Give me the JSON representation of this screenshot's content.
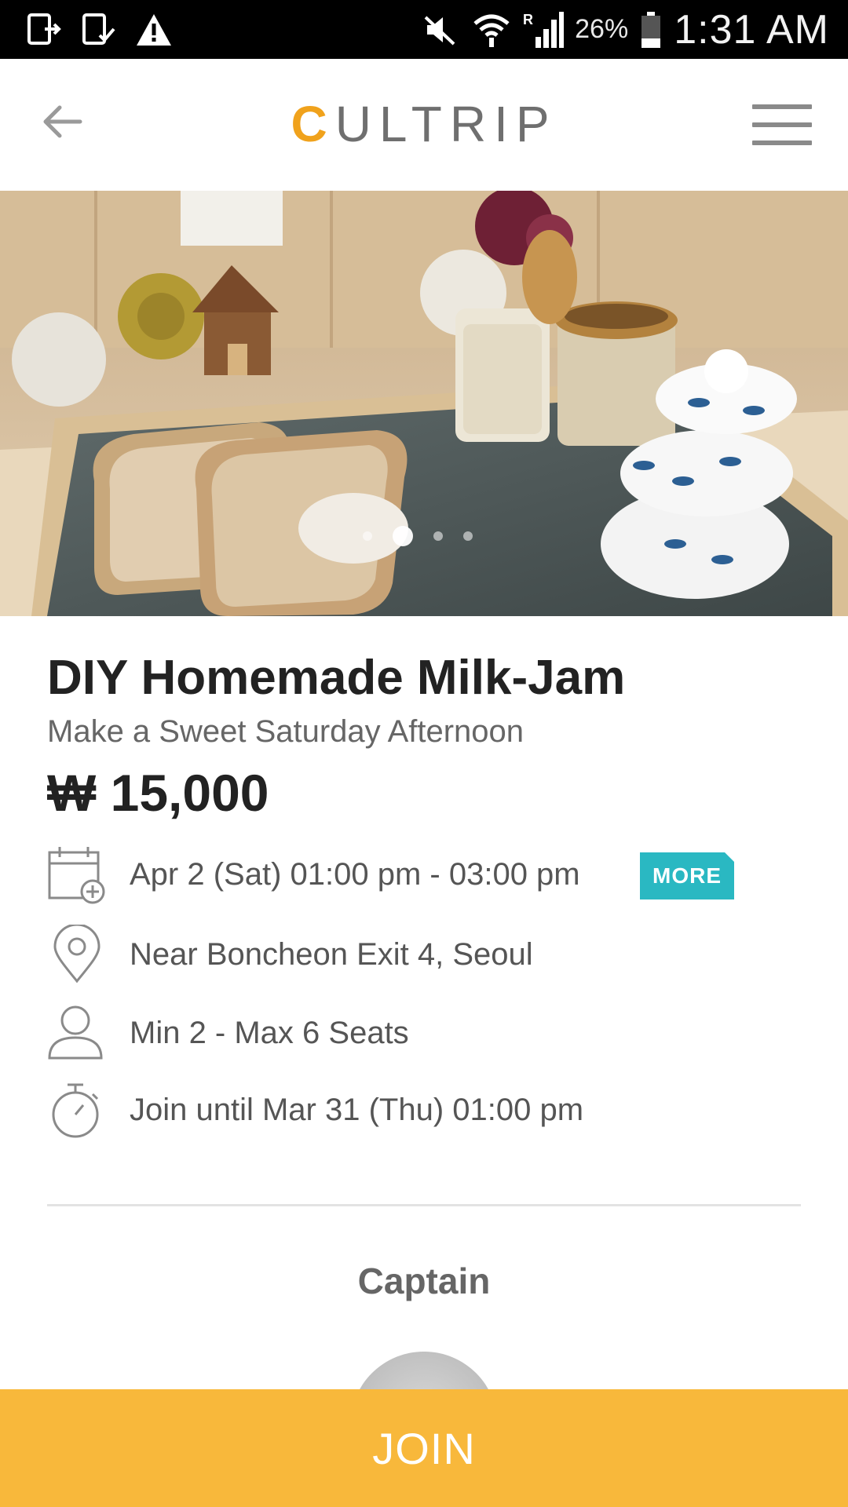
{
  "status_bar": {
    "battery_percent": "26%",
    "time": "1:31 AM",
    "icons": [
      "download-icon",
      "download-done-icon",
      "warning-icon",
      "mute-icon",
      "wifi-icon",
      "signal-icon",
      "battery-icon"
    ]
  },
  "header": {
    "logo": {
      "first_letter": "C",
      "rest": "ULTRIP"
    },
    "back_icon": "back-arrow-icon",
    "menu_icon": "hamburger-menu-icon",
    "accent_color": "#f0a21c"
  },
  "carousel": {
    "total_slides": 4,
    "active_slide": 2
  },
  "event": {
    "title": "DIY Homemade Milk-Jam",
    "subtitle": "Make a Sweet Saturday Afternoon",
    "price": "₩ 15,000",
    "details": [
      {
        "icon": "calendar-add-icon",
        "text": "Apr 2 (Sat) 01:00 pm - 03:00 pm"
      },
      {
        "icon": "location-pin-icon",
        "text": "Near Boncheon Exit 4, Seoul"
      },
      {
        "icon": "person-icon",
        "text": "Min 2 - Max 6 Seats"
      },
      {
        "icon": "stopwatch-icon",
        "text": "Join until Mar 31 (Thu) 01:00 pm"
      }
    ],
    "more_label": "MORE",
    "more_color": "#2ab8c2"
  },
  "captain": {
    "heading": "Captain"
  },
  "join": {
    "label": "JOIN",
    "color": "#f8b83b"
  }
}
